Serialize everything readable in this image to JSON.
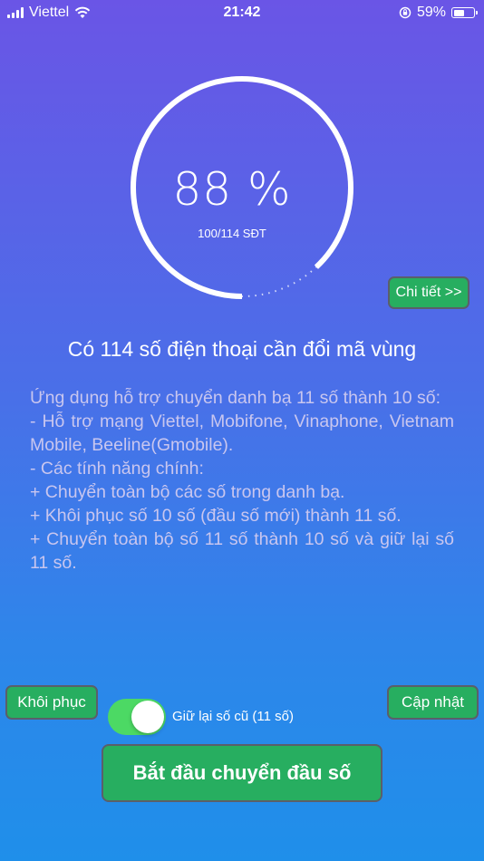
{
  "status_bar": {
    "carrier": "Viettel",
    "time": "21:42",
    "battery_percent": "59%",
    "battery_level": 0.59,
    "icons": [
      "signal-icon",
      "wifi-icon",
      "orientation-lock-icon",
      "battery-icon"
    ]
  },
  "progress": {
    "percent_text": "88 %",
    "fraction": 0.88,
    "count_text": "100/114 SĐT"
  },
  "detail_button": "Chi tiết >>",
  "headline": "Có 114 số điện thoại cần đổi mã vùng",
  "description": "Ứng dụng hỗ trợ chuyển danh bạ 11 số thành 10 số:\n- Hỗ trợ mạng Viettel, Mobifone, Vinaphone, Vietnam Mobile, Beeline(Gmobile).\n- Các tính năng chính:\n+ Chuyển toàn bộ các số trong danh bạ.\n+ Khôi phục số 10 số (đầu số mới) thành 11 số.\n+ Chuyển toàn bộ số 11 số thành 10 số và giữ lại số 11 số.",
  "buttons": {
    "restore": "Khôi phục",
    "update": "Cập nhật",
    "start": "Bắt đầu chuyển đầu số"
  },
  "toggle": {
    "label": "Giữ lại số cũ (11 số)",
    "on": true
  },
  "colors": {
    "button_green": "#27ae60",
    "toggle_on": "#4cd964"
  }
}
